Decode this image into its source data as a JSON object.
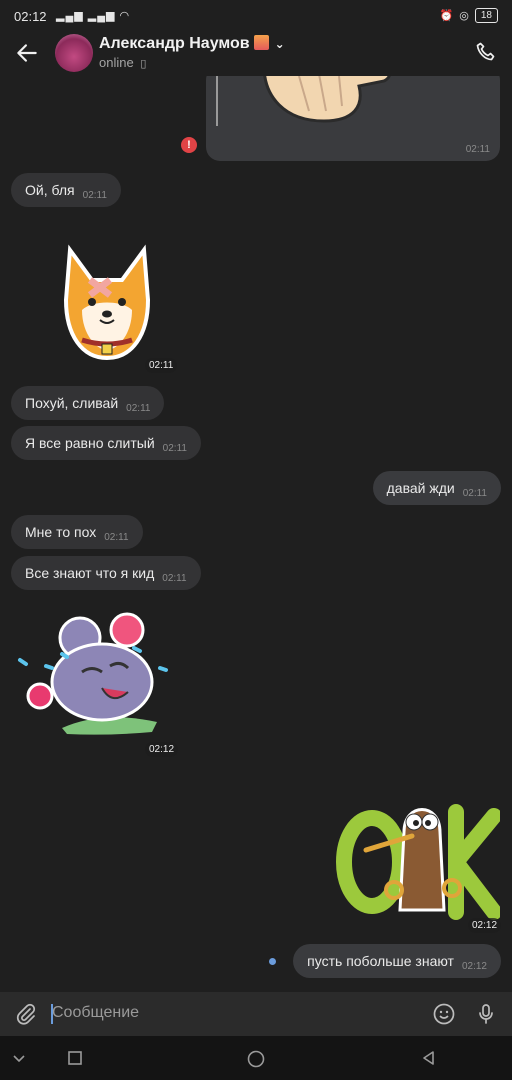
{
  "status_bar": {
    "time": "02:12",
    "battery": "18"
  },
  "header": {
    "contact_name": "Александр Наумов",
    "status": "online"
  },
  "messages": [
    {
      "text": "Ой, бля",
      "time": "02:11"
    },
    {
      "sticker": "shiba-dog-sticker",
      "time": "02:11"
    },
    {
      "text": "Похуй, сливай",
      "time": "02:11"
    },
    {
      "text": "Я все равно слитый",
      "time": "02:11"
    },
    {
      "text": "давай жди",
      "time": "02:11"
    },
    {
      "text": "Мне то пох",
      "time": "02:11"
    },
    {
      "text": "Все знают что я кид",
      "time": "02:11"
    },
    {
      "sticker": "crying-mouse-sticker",
      "time": "02:12"
    },
    {
      "sticker": "kiwi-ok-sticker",
      "time": "02:12"
    },
    {
      "text": "пусть побольше знают",
      "time": "02:12"
    }
  ],
  "forwarded_top": {
    "time": "02:11"
  },
  "composer": {
    "placeholder": "Сообщение"
  },
  "colors": {
    "background": "#1f1f1f",
    "incoming_bubble": "#333335",
    "outgoing_bubble": "#3a3b3e",
    "error": "#e14346",
    "unread_dot": "#6b9cdc"
  }
}
